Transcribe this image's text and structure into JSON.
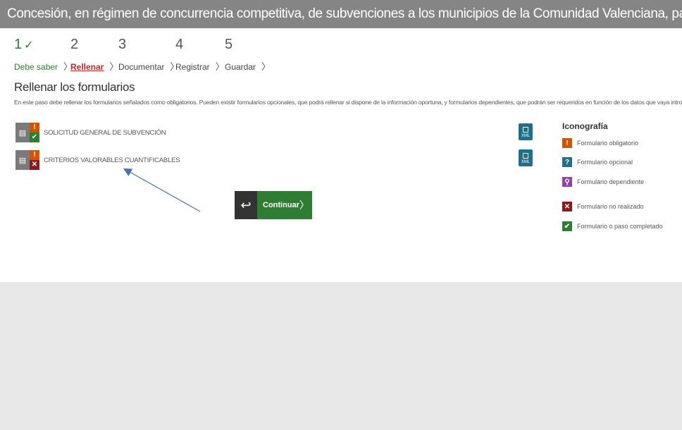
{
  "header": {
    "title": "Concesión, en régimen de concurrencia competitiva, de subvenciones a los municipios de la Comunidad Valenciana, para la realización de actividades extrae..."
  },
  "steps": [
    {
      "number": "1",
      "label": "Debe saber",
      "state": "done"
    },
    {
      "number": "2",
      "label": "Rellenar",
      "state": "active"
    },
    {
      "number": "3",
      "label": "Documentar",
      "state": "pending"
    },
    {
      "number": "4",
      "label": "Registrar",
      "state": "pending"
    },
    {
      "number": "5",
      "label": "Guardar",
      "state": "pending"
    }
  ],
  "page": {
    "heading": "Rellenar los formularios",
    "description": "En este paso debe rellenar los formularios señalados como obligatorios. Pueden existir formularios opcionales, que podrá rellenar si dispone de la información oportuna, y formularios dependientes, que podrán ser requeridos en función de los datos que vaya introduciendo."
  },
  "forms": [
    {
      "name": "SOLICITUD GENERAL DE SUBVENCIÓN",
      "required": true,
      "status": "completed",
      "xml_label": "XML"
    },
    {
      "name": "CRITERIOS VALORABLES CUANTIFICABLES",
      "required": true,
      "status": "not_done",
      "xml_label": "XML"
    }
  ],
  "legend": {
    "title": "Iconografía",
    "items": [
      {
        "icon": "exclamation-icon",
        "color": "#d35400",
        "label": "Formulario obligatorio"
      },
      {
        "icon": "question-icon",
        "color": "#1e6f8c",
        "label": "Formulario opcional"
      },
      {
        "icon": "link-icon",
        "color": "#8e44ad",
        "label": "Formulario dependiente"
      },
      {
        "icon": "x-icon",
        "color": "#8b1a1a",
        "label": "Formulario no realizado"
      },
      {
        "icon": "check-icon",
        "color": "#2e7d32",
        "label": "Formulario o paso completado"
      }
    ]
  },
  "buttons": {
    "continue_label": "Continuar"
  },
  "colors": {
    "header_bg": "#858585",
    "accent_green": "#2e7d32",
    "active_red": "#c62828",
    "annotation_arrow": "#4a6fb5"
  }
}
